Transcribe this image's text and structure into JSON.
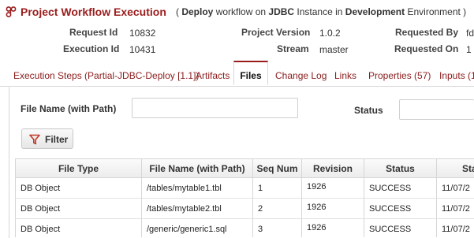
{
  "header": {
    "title": "Project Workflow Execution",
    "subtitle_open": "( ",
    "deploy": "Deploy",
    "workflow_on": " workflow on ",
    "instance": "JDBC",
    "instance_in": " Instance in ",
    "environment": "Development",
    "environment_suffix": " Environment )"
  },
  "info": {
    "request_id_label": "Request Id",
    "request_id_value": "10832",
    "execution_id_label": "Execution Id",
    "execution_id_value": "10431",
    "project_version_label": "Project Version",
    "project_version_value": "1.0.2",
    "stream_label": "Stream",
    "stream_value": "master",
    "requested_by_label": "Requested By",
    "requested_by_value": "fd",
    "requested_on_label": "Requested On",
    "requested_on_value": "1"
  },
  "tabs": [
    {
      "label": "Execution Steps (Partial-JDBC-Deploy [1.1])"
    },
    {
      "label": "Artifacts"
    },
    {
      "label": "Files"
    },
    {
      "label": "Change Log"
    },
    {
      "label": "Links"
    },
    {
      "label": "Properties (57)"
    },
    {
      "label": "Inputs (1"
    }
  ],
  "active_tab": "Files",
  "filter": {
    "file_name_label": "File Name (with Path)",
    "status_label": "Status",
    "button_label": "Filter"
  },
  "table": {
    "columns": [
      "File Type",
      "File Name (with Path)",
      "Seq Num",
      "Revision",
      "Status",
      "Star"
    ],
    "rows": [
      [
        "DB Object",
        "/tables/mytable1.tbl",
        "1",
        "1926",
        "SUCCESS",
        "11/07/2"
      ],
      [
        "DB Object",
        "/tables/mytable2.tbl",
        "2",
        "1926",
        "SUCCESS",
        "11/07/2"
      ],
      [
        "DB Object",
        "/generic/generic1.sql",
        "3",
        "1926",
        "SUCCESS",
        "11/07/2"
      ]
    ]
  },
  "colors": {
    "brand": "#9b1c1c",
    "tab_link": "#8a1c1c",
    "filter_icon": "#c0392b"
  }
}
